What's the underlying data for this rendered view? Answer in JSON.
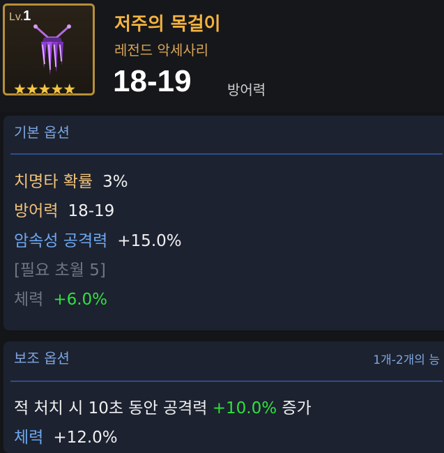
{
  "item": {
    "level_prefix": "Lv.",
    "level": "1",
    "icon": "purple-crystal-necklace-icon",
    "star_icon": "star-icon",
    "stars": "★★★★★",
    "star_count": 5,
    "name": "저주의 목걸이",
    "grade": "레전드 악세사리",
    "defense_value": "18-19",
    "defense_label": "방어력"
  },
  "basic_options": {
    "title": "기본 옵션",
    "crit": {
      "label": "치명타 확률",
      "value": "3%"
    },
    "defense": {
      "label": "방어력",
      "value": "18-19"
    },
    "dark_attack": {
      "label": "암속성 공격력",
      "value": "+15.0%"
    },
    "requirement": "[필요 초월 5]",
    "stamina": {
      "label": "체력",
      "value": "+6.0%"
    }
  },
  "sub_options": {
    "title": "보조 옵션",
    "note": "1개-2개의 능",
    "kill_bonus": {
      "prefix": "적 처치 시 10초 동안 공격력",
      "value": "+10.0%",
      "suffix": "증가"
    },
    "stamina": {
      "label": "체력",
      "value": "+12.0%"
    }
  },
  "colors": {
    "background": "#141518",
    "panel": "#1c2230",
    "item_name": "#f4b340",
    "accent_blue": "#7ea6e0",
    "positive_green": "#2fe23c",
    "frame_gold": "#b88f3a"
  }
}
